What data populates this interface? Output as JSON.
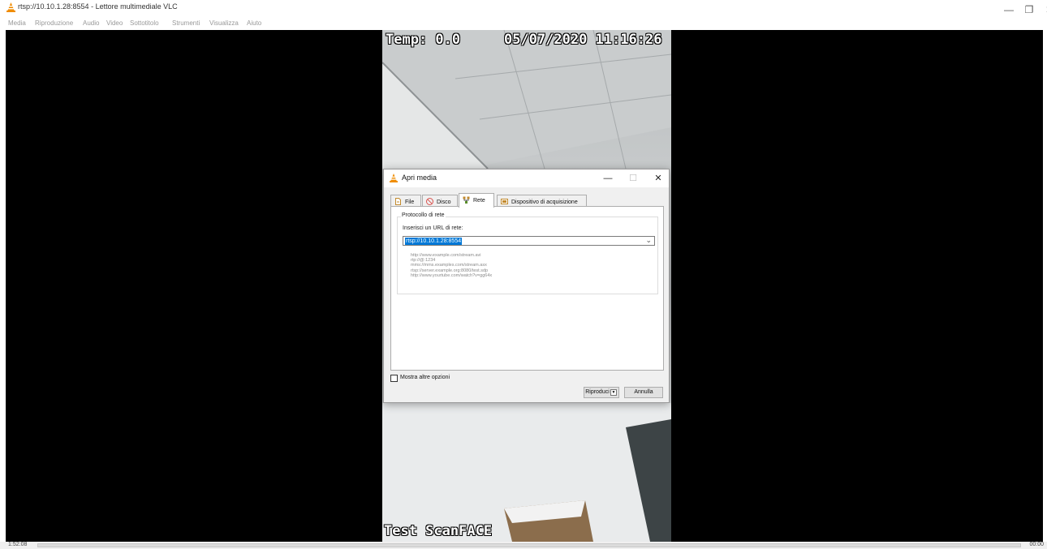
{
  "window": {
    "title": "rtsp://10.10.1.28:8554 - Lettore multimediale VLC",
    "controls": {
      "minimize": "—",
      "restore": "❐",
      "close": "✕"
    }
  },
  "menu": [
    "Media",
    "Riproduzione",
    "Audio",
    "Video",
    "Sottotitolo",
    "Strumenti",
    "Visualizza",
    "Aiuto"
  ],
  "video": {
    "osd_temp": "Temp: 0.0",
    "osd_datetime": "05/07/2020 11:16:26",
    "osd_bottom": "Test ScanFACE"
  },
  "status": {
    "elapsed": "1:52:08",
    "remaining": "00:00",
    "progress": 0
  },
  "dialog": {
    "title": "Apri media",
    "controls": {
      "minimize": "—",
      "maximize": "☐",
      "close": "✕"
    },
    "tabs": [
      {
        "label": "File",
        "icon": "file-icon",
        "active": false
      },
      {
        "label": "Disco",
        "icon": "disc-icon",
        "active": false
      },
      {
        "label": "Rete",
        "icon": "network-icon",
        "active": true
      },
      {
        "label": "Dispositivo di acquisizione",
        "icon": "capture-device-icon",
        "active": false
      }
    ],
    "protocol_group_label": "Protocollo di rete",
    "url_label": "Inserisci un URL di rete:",
    "url_value": "rtsp://10.10.1.28:8554",
    "examples": [
      "http://www.example.com/stream.avi",
      "rtp://@:1234",
      "mms://mms.examples.com/stream.asx",
      "rtsp://server.example.org:8080/test.sdp",
      "http://www.yourtube.com/watch?v=gg64x"
    ],
    "more_options_label": "Mostra altre opzioni",
    "more_options_checked": false,
    "play_button": "Riproduci",
    "play_dropdown": "▼",
    "cancel_button": "Annulla"
  },
  "colors": {
    "accent": "#0078d7",
    "vlc_orange": "#f08c00"
  }
}
